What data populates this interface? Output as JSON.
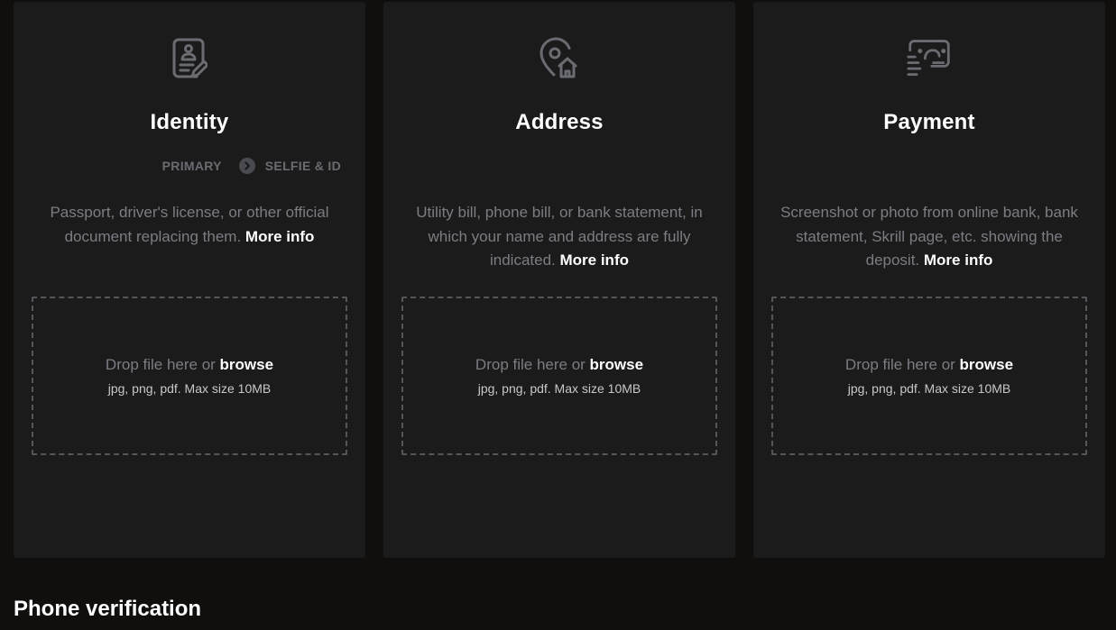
{
  "cards": [
    {
      "title": "Identity",
      "icon": "id-document-icon",
      "steps": [
        "PRIMARY",
        "SELFIE & ID"
      ],
      "description": "Passport, driver's license, or other official document replacing them.",
      "more_info": "More info",
      "drop_text": "Drop file here or",
      "browse": "browse",
      "hint": "jpg, png, pdf. Max size 10MB"
    },
    {
      "title": "Address",
      "icon": "location-home-icon",
      "description": "Utility bill, phone bill, or bank statement, in which your name and address are fully indicated.",
      "more_info": "More info",
      "drop_text": "Drop file here or",
      "browse": "browse",
      "hint": "jpg, png, pdf. Max size 10MB"
    },
    {
      "title": "Payment",
      "icon": "payment-screen-icon",
      "description": "Screenshot or photo from online bank, bank statement, Skrill page, etc. showing the deposit.",
      "more_info": "More info",
      "drop_text": "Drop file here or",
      "browse": "browse",
      "hint": "jpg, png, pdf. Max size 10MB"
    }
  ],
  "phone_section": {
    "title": "Phone verification"
  },
  "colors": {
    "page_bg": "#110f0d",
    "card_bg": "#1b1b1c",
    "muted_text": "#7c7d83",
    "icon": "#6b6c72",
    "dash_border": "#55565c"
  }
}
